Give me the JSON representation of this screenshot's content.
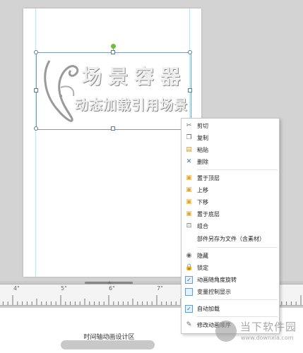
{
  "canvas": {
    "logo_line1": "场景容器",
    "logo_line2": "动态加载引用场景"
  },
  "ruler": {
    "labels": [
      "4\"",
      "5\"",
      "6\"",
      "7\""
    ]
  },
  "timeline": {
    "label": "时间轴动画设计区"
  },
  "context_menu": {
    "items": [
      {
        "label": "剪切",
        "icon": "scissors-icon"
      },
      {
        "label": "复制",
        "icon": "copy-icon"
      },
      {
        "label": "粘贴",
        "icon": "paste-icon"
      },
      {
        "label": "删除",
        "icon": "delete-x-icon"
      },
      {
        "label": "置于顶层",
        "icon": "bring-to-front-icon"
      },
      {
        "label": "上移",
        "icon": "move-up-icon"
      },
      {
        "label": "下移",
        "icon": "move-down-icon"
      },
      {
        "label": "置于底层",
        "icon": "send-to-back-icon"
      },
      {
        "label": "组合",
        "icon": "group-icon"
      },
      {
        "label": "部件另存为文件（含素材）",
        "icon": ""
      },
      {
        "label": "隐藏",
        "icon": "eye-icon"
      },
      {
        "label": "锁定",
        "icon": "lock-icon"
      },
      {
        "label": "动画随角度旋转",
        "icon": "checkbox-checked-icon"
      },
      {
        "label": "变量控制显示",
        "icon": "checkbox-unchecked-icon"
      },
      {
        "label": "自动加载",
        "icon": "checkbox-checked-icon"
      },
      {
        "label": "修改动画顺序",
        "icon": "edit-order-icon"
      }
    ]
  },
  "watermark": {
    "title": "当下软件园",
    "url": "www.downxia.com"
  },
  "colors": {
    "selection_border": "#7a9bb8",
    "rotation_handle": "#6dbf3a",
    "checkbox_accent": "#2b6aa8"
  }
}
